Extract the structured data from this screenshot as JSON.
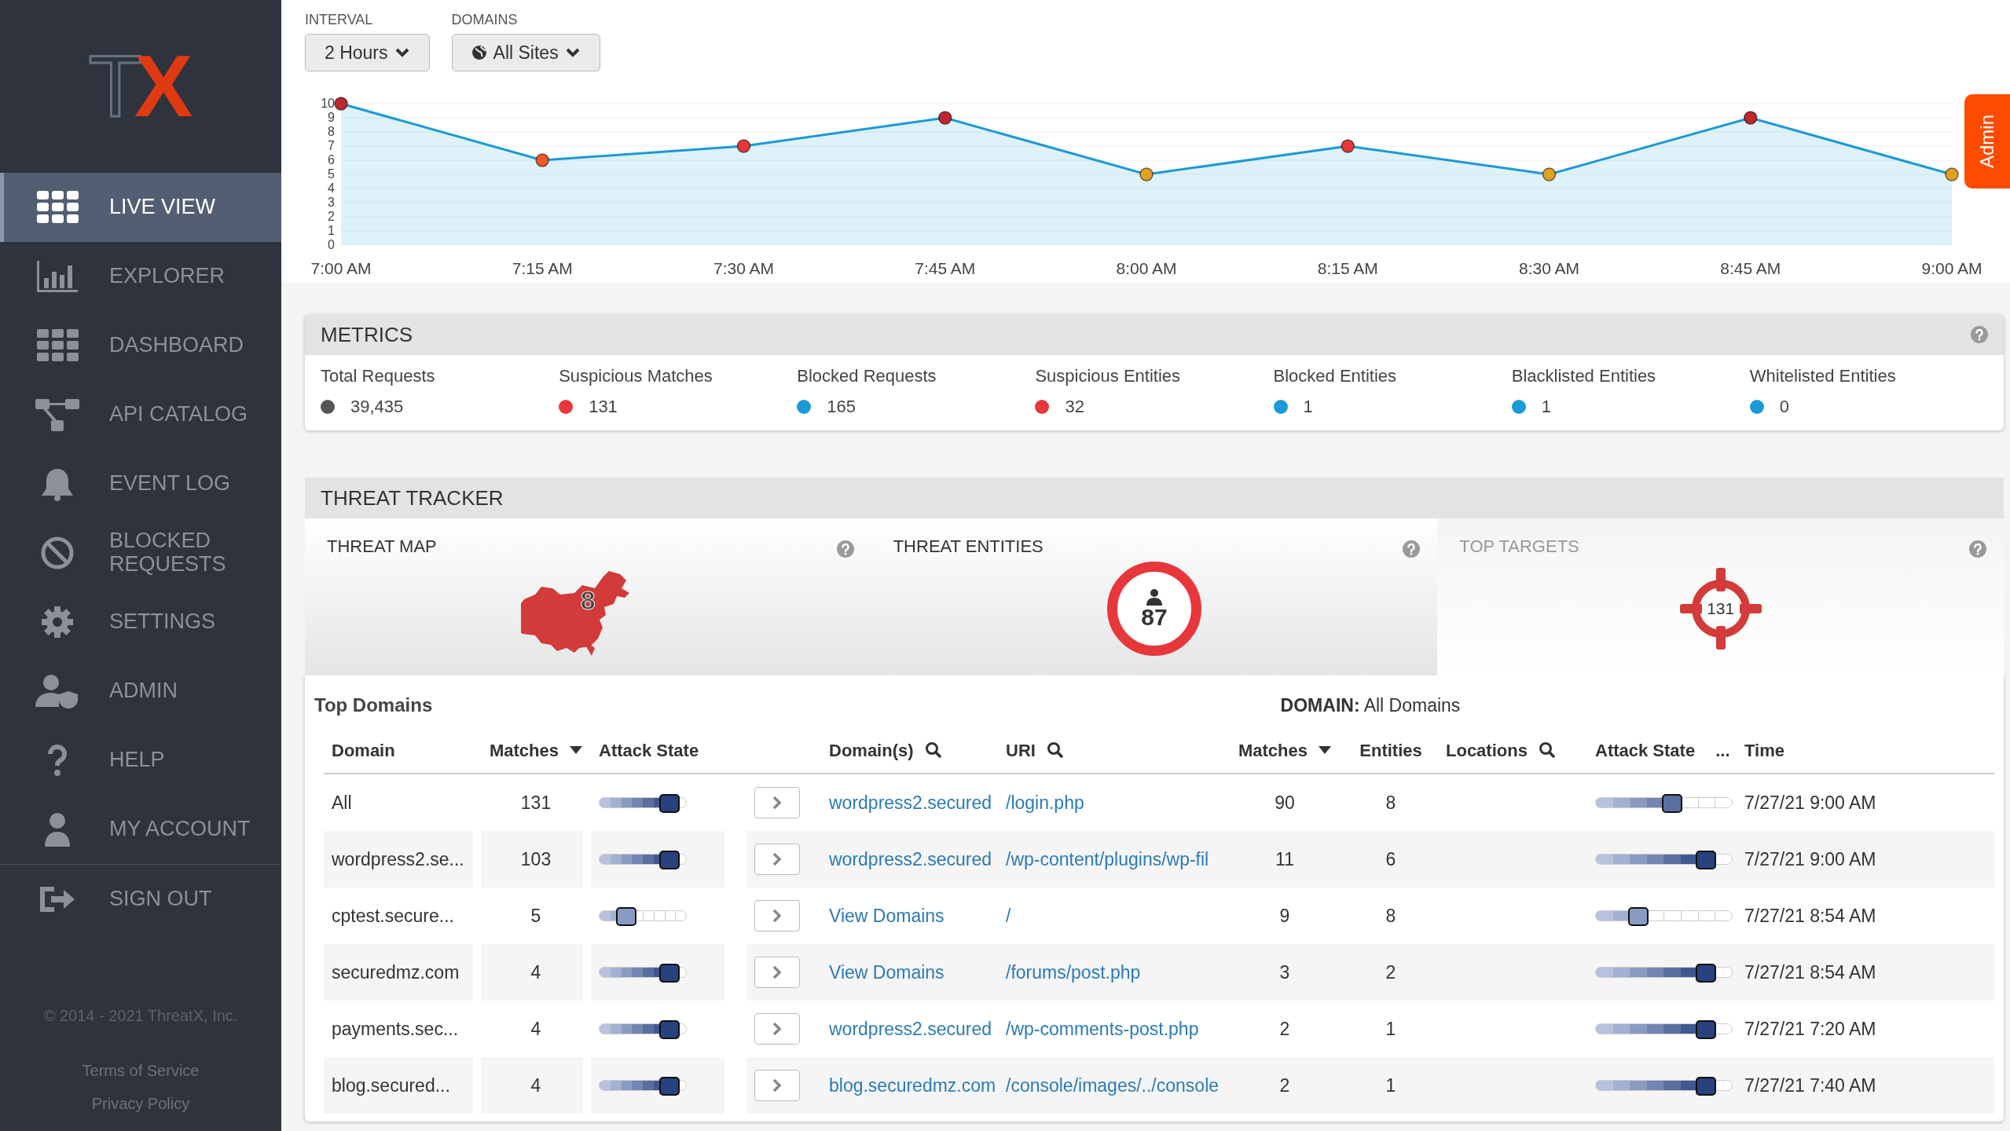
{
  "sidebar": {
    "logo": "TX",
    "items": [
      {
        "label": "LIVE VIEW",
        "selected": true
      },
      {
        "label": "EXPLORER",
        "selected": false
      },
      {
        "label": "DASHBOARD",
        "selected": false
      },
      {
        "label": "API CATALOG",
        "selected": false
      },
      {
        "label": "EVENT LOG",
        "selected": false
      },
      {
        "label": "BLOCKED REQUESTS",
        "selected": false
      },
      {
        "label": "SETTINGS",
        "selected": false
      },
      {
        "label": "ADMIN",
        "selected": false
      },
      {
        "label": "HELP",
        "selected": false
      },
      {
        "label": "MY ACCOUNT",
        "selected": false
      }
    ],
    "bottom_items": [
      {
        "label": "SIGN OUT",
        "selected": false
      }
    ],
    "copyright": "© 2014 - 2021 ThreatX, Inc.",
    "links": [
      "Terms of Service",
      "Privacy Policy"
    ]
  },
  "filters": [
    {
      "label": "INTERVAL",
      "value": "2 Hours"
    },
    {
      "label": "DOMAINS",
      "value": "All Sites"
    }
  ],
  "chart": {
    "chart_data": {
      "type": "area",
      "categories": [
        "7:00 AM",
        "7:15 AM",
        "7:30 AM",
        "7:45 AM",
        "8:00 AM",
        "8:15 AM",
        "8:30 AM",
        "8:45 AM",
        "9:00 AM"
      ],
      "ylim": [
        0,
        10
      ],
      "yticks": [
        0,
        1,
        2,
        3,
        4,
        5,
        6,
        7,
        8,
        9,
        10
      ],
      "grid": true,
      "series": [
        {
          "color": "#1a9ad6",
          "values": [
            10,
            6,
            7,
            9,
            5,
            7,
            5,
            9,
            5
          ]
        }
      ]
    }
  },
  "admin_tab": {
    "label": "Admin"
  },
  "metrics": {
    "title": "METRICS",
    "items": [
      {
        "label": "Total Requests",
        "value": "39,435",
        "color": "#555555"
      },
      {
        "label": "Suspicious Matches",
        "value": "131",
        "color": "#e8373a"
      },
      {
        "label": "Blocked Requests",
        "value": "165",
        "color": "#1a9ad6"
      },
      {
        "label": "Suspicious Entities",
        "value": "32",
        "color": "#e8373a"
      },
      {
        "label": "Blocked Entities",
        "value": "1",
        "color": "#1a9ad6"
      },
      {
        "label": "Blacklisted Entities",
        "value": "1",
        "color": "#1a9ad6"
      },
      {
        "label": "Whitelisted Entities",
        "value": "0",
        "color": "#1a9ad6"
      }
    ]
  },
  "threat_tracker": {
    "title": "THREAT TRACKER",
    "panels": [
      {
        "kind": "map",
        "title": "THREAT MAP",
        "count": "8",
        "active": true
      },
      {
        "kind": "entities",
        "title": "THREAT ENTITIES",
        "count": "87",
        "active": true
      },
      {
        "kind": "targets",
        "title": "TOP TARGETS",
        "count": "131",
        "active": false
      }
    ]
  },
  "top_domains": {
    "title": "Top Domains",
    "columns": [
      {
        "label": "Domain"
      },
      {
        "label": "Matches",
        "sorted": true
      },
      {
        "label": "Attack State"
      }
    ],
    "rows": [
      {
        "domain": "All",
        "matches": "131",
        "level": 0.81
      },
      {
        "domain": "wordpress2.se...",
        "matches": "103",
        "level": 0.81
      },
      {
        "domain": "cptest.secure...",
        "matches": "5",
        "level": 0.31
      },
      {
        "domain": "securedmz.com",
        "matches": "4",
        "level": 0.81
      },
      {
        "domain": "payments.sec...",
        "matches": "4",
        "level": 0.81
      },
      {
        "domain": "blog.secured...",
        "matches": "4",
        "level": 0.81
      }
    ]
  },
  "domain_detail": {
    "heading": "**DOMAIN:** All Domains",
    "columns": [
      {
        "label": "Domain(s)",
        "search": true
      },
      {
        "label": "URI",
        "search": true
      },
      {
        "label": "Matches",
        "sorted": true
      },
      {
        "label": "Entities"
      },
      {
        "label": "Locations",
        "search": true
      },
      {
        "label": "Attack State",
        "menu": "..."
      },
      {
        "label": "Time"
      }
    ],
    "rows": [
      {
        "domain": "wordpress2.secured",
        "uri": "/login.php",
        "matches": "90",
        "entities": "8",
        "level": 0.56,
        "time": "7/27/21 9:00 AM"
      },
      {
        "domain": "wordpress2.secured",
        "uri": "/wp-content/plugins/wp-fil",
        "matches": "11",
        "entities": "6",
        "level": 0.81,
        "time": "7/27/21 9:00 AM"
      },
      {
        "domain": "View Domains",
        "uri": "/",
        "matches": "9",
        "entities": "8",
        "level": 0.31,
        "time": "7/27/21 8:54 AM"
      },
      {
        "domain": "View Domains",
        "uri": "/forums/post.php",
        "matches": "3",
        "entities": "2",
        "level": 0.81,
        "time": "7/27/21 8:54 AM"
      },
      {
        "domain": "wordpress2.secured",
        "uri": "/wp-comments-post.php",
        "matches": "2",
        "entities": "1",
        "level": 0.81,
        "time": "7/27/21 7:20 AM"
      },
      {
        "domain": "blog.securedmz.com",
        "uri": "/console/images/../console",
        "matches": "2",
        "entities": "1",
        "level": 0.81,
        "time": "7/27/21 7:40 AM"
      }
    ]
  }
}
